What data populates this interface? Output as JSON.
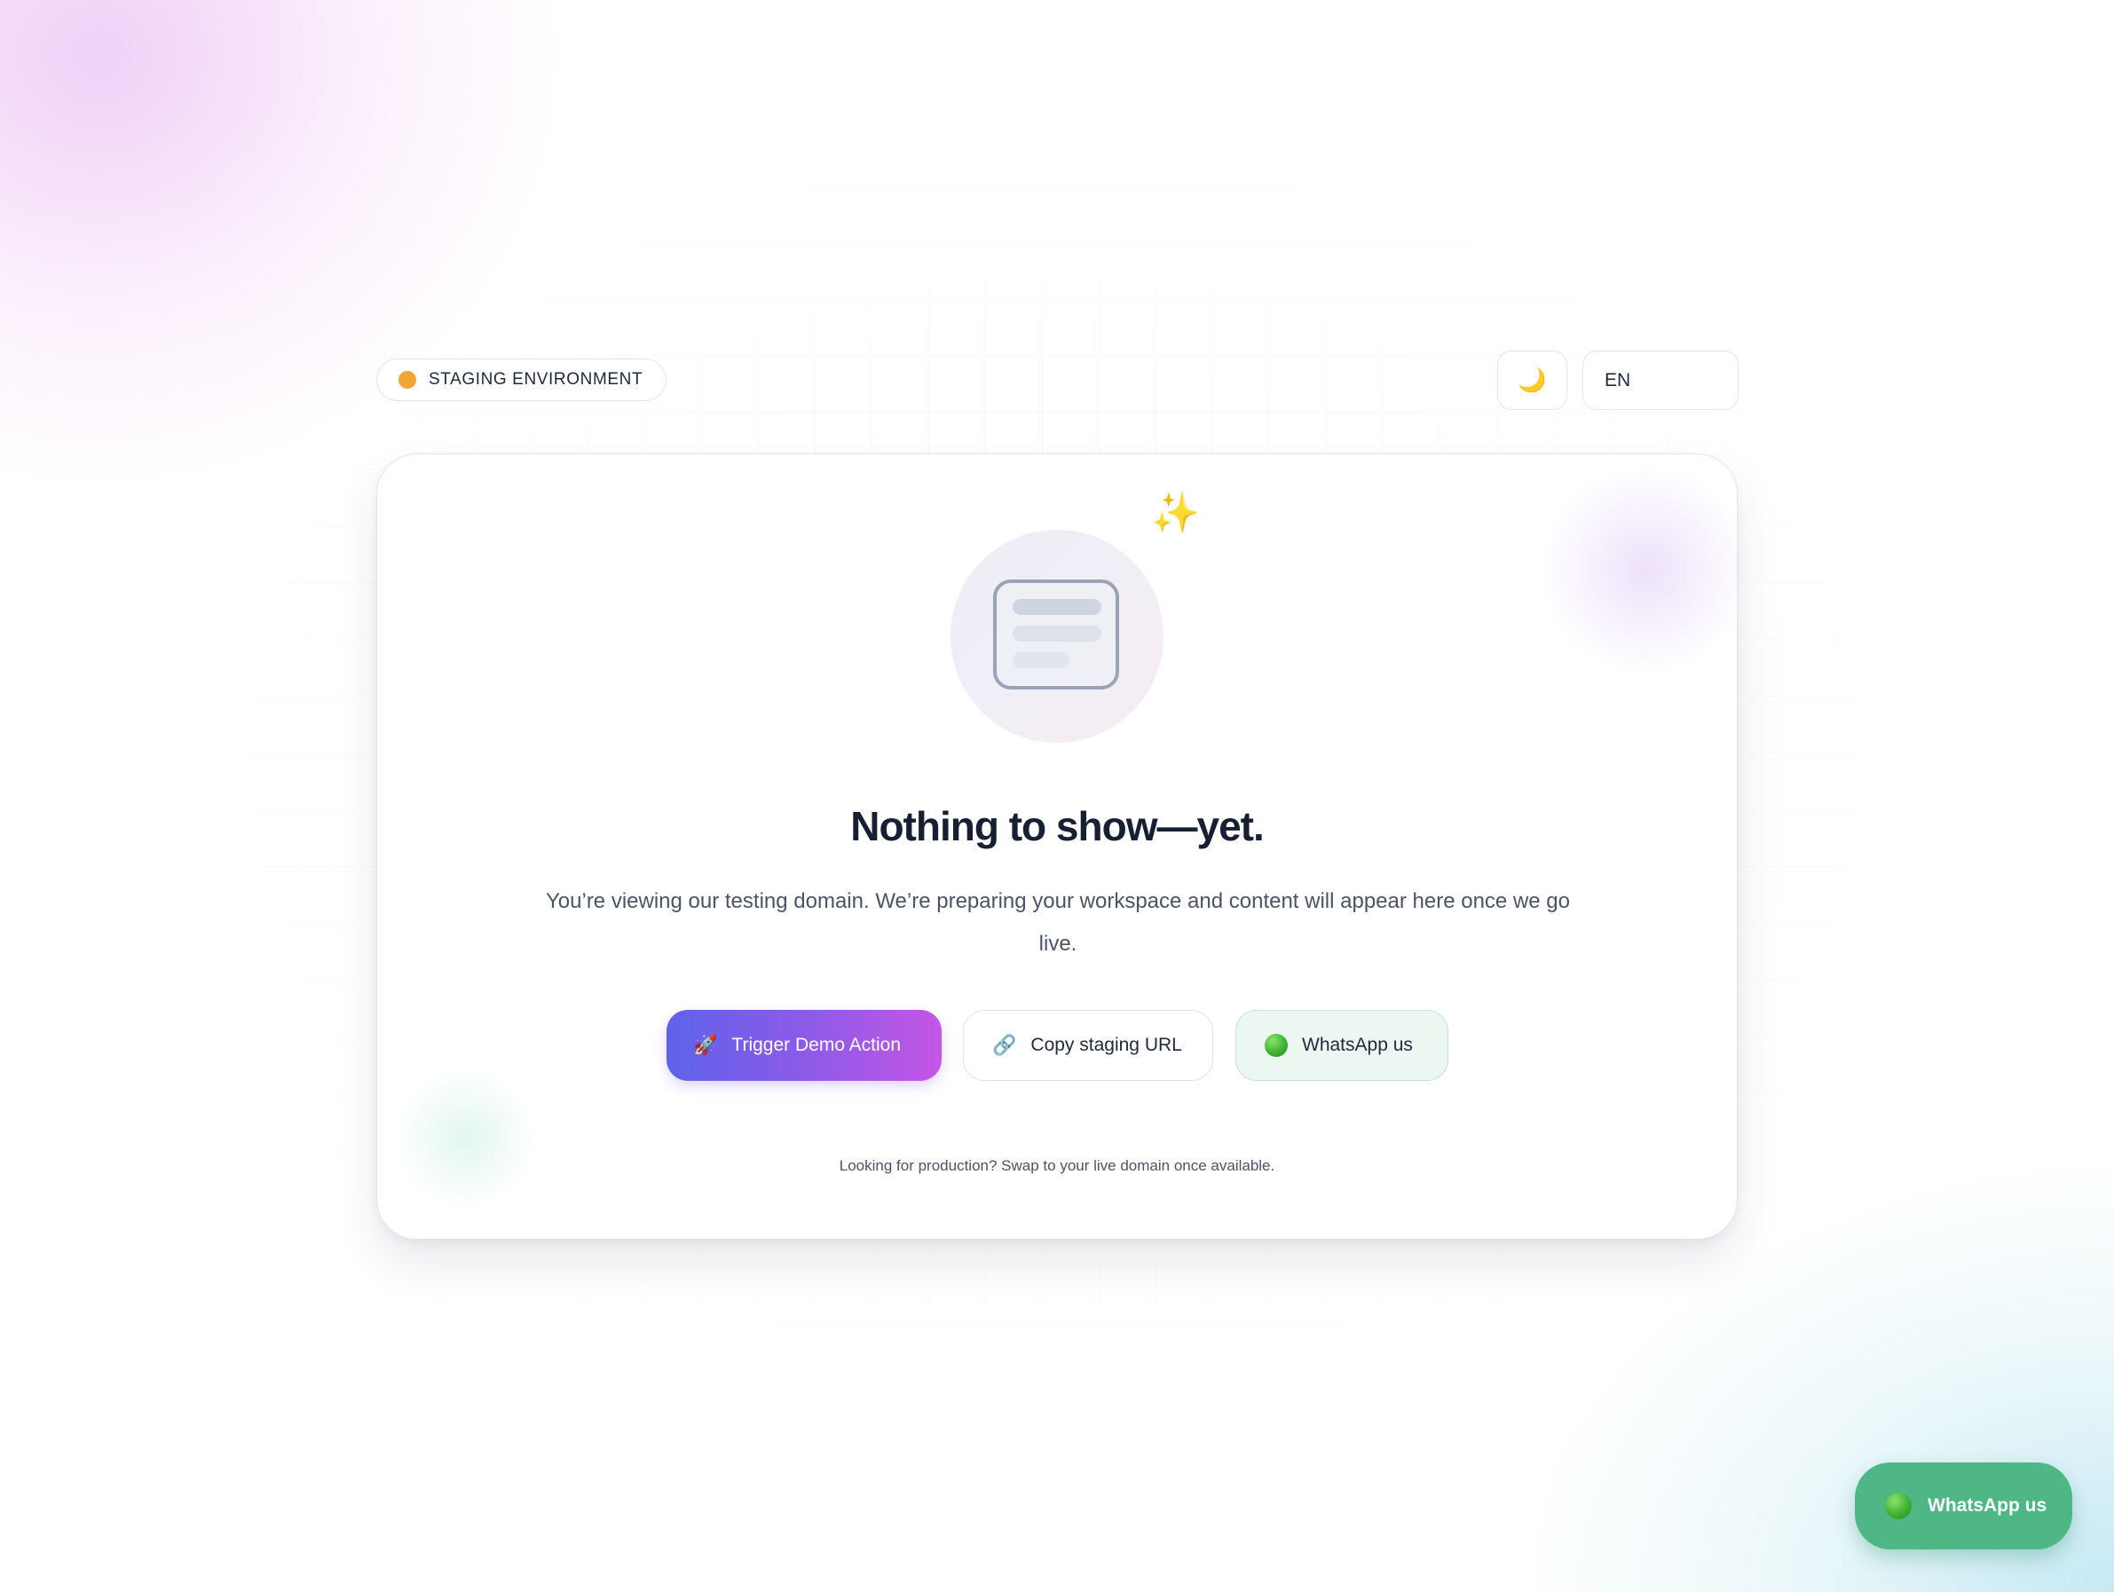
{
  "header": {
    "environment_label": "STAGING ENVIRONMENT",
    "theme_toggle_icon": "🌙",
    "language": "EN"
  },
  "empty_state": {
    "sparkles_icon": "✨",
    "title": "Nothing to show—yet.",
    "description": "You’re viewing our testing domain. We’re preparing your workspace and content will appear here once we go live.",
    "footnote": "Looking for production? Swap to your live domain once available."
  },
  "actions": {
    "primary": {
      "icon": "🚀",
      "label": "Trigger Demo Action"
    },
    "copy": {
      "icon": "🔗",
      "label": "Copy staging URL"
    },
    "whatsapp": {
      "label": "WhatsApp us"
    }
  },
  "floating_whatsapp": {
    "label": "WhatsApp us"
  },
  "colors": {
    "status_dot": "#f0a434",
    "primary_gradient_start": "#5e63ea",
    "primary_gradient_end": "#c456e6",
    "whatsapp_green": "#4fb786",
    "title_text": "#172033"
  }
}
